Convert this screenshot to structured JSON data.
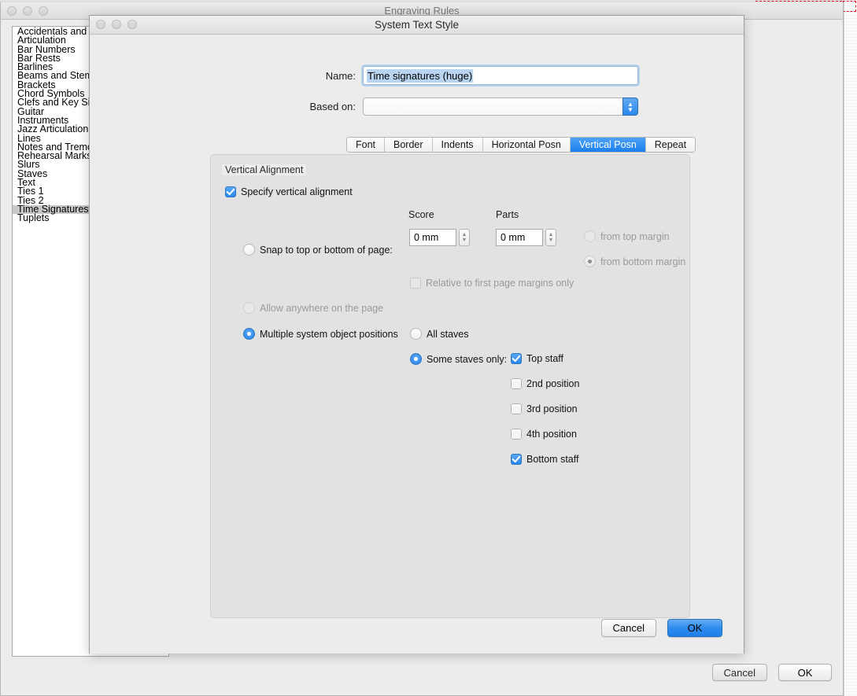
{
  "background_window": {
    "title": "Engraving Rules",
    "traffic_lights": [
      "close-button",
      "minimize-button",
      "zoom-button"
    ],
    "sidebar_items": [
      "Accidentals and Do",
      "Articulation",
      "Bar Numbers",
      "Bar Rests",
      "Barlines",
      "Beams and Stems",
      "Brackets",
      "Chord Symbols",
      "Clefs and Key Sign",
      "Guitar",
      "Instruments",
      "Jazz Articulations",
      "Lines",
      "Notes and Tremolo",
      "Rehearsal Marks",
      "Slurs",
      "Staves",
      "Text",
      "Ties 1",
      "Ties 2",
      "Time Signatures",
      "Tuplets"
    ],
    "selected_sidebar_item": "Time Signatures",
    "cancel_label": "Cancel",
    "ok_label": "OK"
  },
  "sheet": {
    "title": "System Text Style",
    "name_label": "Name:",
    "name_value": "Time signatures (huge)",
    "based_on_label": "Based on:",
    "based_on_value": "",
    "tabs": [
      {
        "label": "Font",
        "active": false
      },
      {
        "label": "Border",
        "active": false
      },
      {
        "label": "Indents",
        "active": false
      },
      {
        "label": "Horizontal Posn",
        "active": false
      },
      {
        "label": "Vertical Posn",
        "active": true
      },
      {
        "label": "Repeat",
        "active": false
      }
    ],
    "group_title": "Vertical Alignment",
    "specify_vertical_alignment": {
      "label": "Specify vertical alignment",
      "checked": true
    },
    "score_column_label": "Score",
    "parts_column_label": "Parts",
    "score_value": "0 mm",
    "parts_value": "0 mm",
    "snap_to_page": {
      "label": "Snap to top or bottom of page:",
      "selected": false
    },
    "margin_options": [
      {
        "label": "from top margin",
        "selected": false,
        "disabled": true
      },
      {
        "label": "from bottom margin",
        "selected": true,
        "disabled": true
      }
    ],
    "relative_first_page": {
      "label": "Relative to first page margins only",
      "checked": false,
      "disabled": true
    },
    "allow_anywhere": {
      "label": "Allow anywhere on the page",
      "selected": false,
      "disabled": true
    },
    "multiple_system_object_positions": {
      "label": "Multiple system object positions",
      "selected": true
    },
    "all_staves": {
      "label": "All staves",
      "selected": false
    },
    "some_staves_only": {
      "label": "Some staves only:",
      "selected": true
    },
    "staff_positions": [
      {
        "label": "Top staff",
        "checked": true
      },
      {
        "label": "2nd position",
        "checked": false
      },
      {
        "label": "3rd position",
        "checked": false
      },
      {
        "label": "4th position",
        "checked": false
      },
      {
        "label": "Bottom staff",
        "checked": true
      }
    ],
    "cancel_label": "Cancel",
    "ok_label": "OK"
  },
  "colors": {
    "accent_blue": "#2b88ea",
    "tab_active": "#1b80ee",
    "selection_highlight": "#b8d4f0",
    "annotation_red": "#d01b1b",
    "list_selected": "#c8c8c8"
  }
}
